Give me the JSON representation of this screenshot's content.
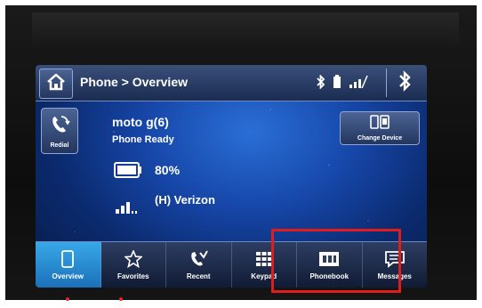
{
  "header": {
    "breadcrumb": "Phone > Overview"
  },
  "left_panel": {
    "redial_label": "Redial"
  },
  "device": {
    "name": "moto g(6)",
    "status": "Phone Ready",
    "battery": "80%",
    "carrier": "(H) Verizon"
  },
  "change_device": {
    "label": "Change Device"
  },
  "tabs": [
    {
      "label": "Overview",
      "icon": "phone-icon",
      "active": true
    },
    {
      "label": "Favorites",
      "icon": "star-icon",
      "active": false
    },
    {
      "label": "Recent",
      "icon": "recent-call-icon",
      "active": false
    },
    {
      "label": "Keypad",
      "icon": "keypad-icon",
      "active": false
    },
    {
      "label": "Phonebook",
      "icon": "phonebook-icon",
      "active": false
    },
    {
      "label": "Messages",
      "icon": "messages-icon",
      "active": false
    }
  ],
  "colors": {
    "highlight": "#e01c1c",
    "active_tab": "#38a8e8",
    "screen_bg": "#1646a8"
  }
}
